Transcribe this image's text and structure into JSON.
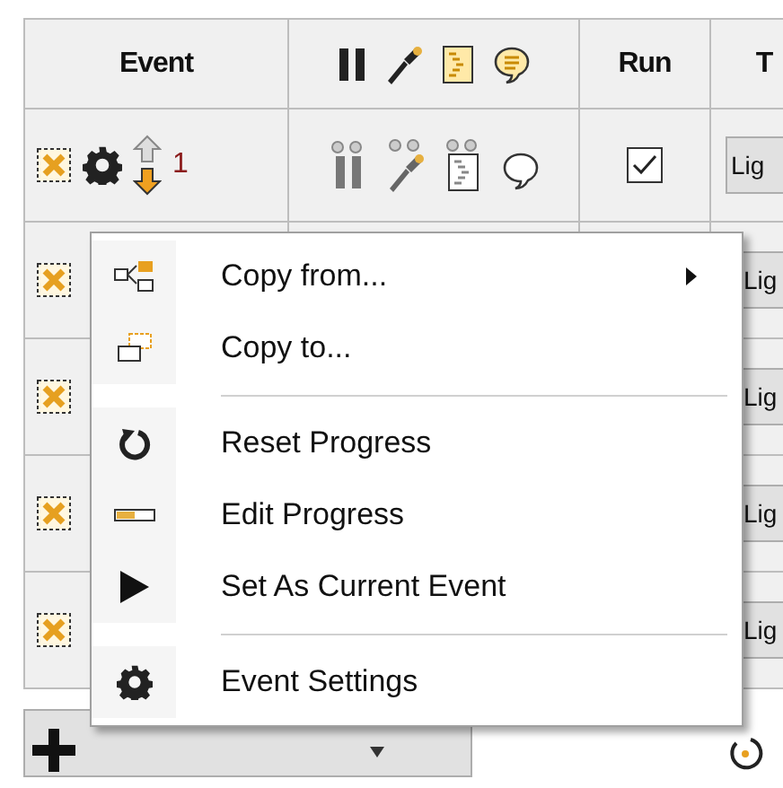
{
  "table": {
    "columns": [
      {
        "kind": "text",
        "label": "Event"
      },
      {
        "kind": "icons"
      },
      {
        "kind": "text",
        "label": "Run"
      },
      {
        "kind": "text",
        "label": "T"
      }
    ],
    "rows": [
      {
        "kind": "full",
        "number": "1",
        "run_checked": true,
        "cell": "Lig"
      },
      {
        "kind": "covered",
        "cell": "Lig"
      },
      {
        "kind": "covered",
        "cell": "Lig"
      },
      {
        "kind": "covered",
        "cell": "Lig"
      },
      {
        "kind": "covered",
        "cell": "Lig"
      }
    ]
  },
  "context_menu": {
    "items": [
      {
        "kind": "item",
        "label": "Copy from...",
        "submenu": true
      },
      {
        "kind": "item",
        "label": "Copy to...",
        "submenu": false
      },
      {
        "kind": "separator"
      },
      {
        "kind": "item",
        "label": "Reset Progress",
        "submenu": false
      },
      {
        "kind": "item",
        "label": "Edit Progress",
        "submenu": false
      },
      {
        "kind": "item",
        "label": "Set As Current Event",
        "submenu": false
      },
      {
        "kind": "separator"
      },
      {
        "kind": "item",
        "label": "Event Settings",
        "submenu": false
      }
    ]
  }
}
